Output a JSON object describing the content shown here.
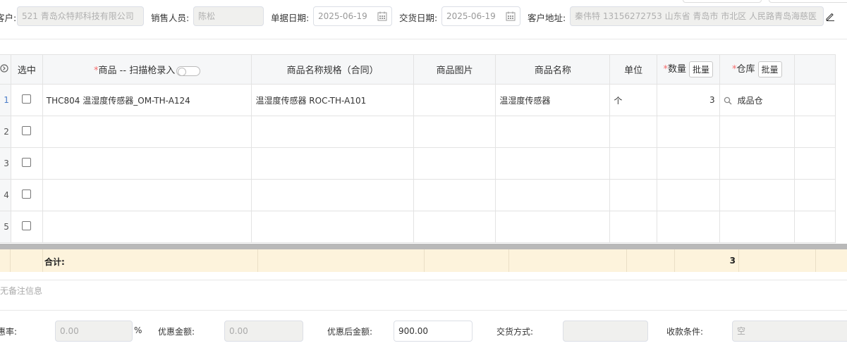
{
  "header": {
    "customer_label": "客户:",
    "customer_value": "521 青岛众特邦科技有限公司",
    "sales_label": "销售人员:",
    "sales_value": "陈松",
    "doc_date_label": "单据日期:",
    "doc_date_value": "2025-06-19",
    "delivery_date_label": "交货日期:",
    "delivery_date_value": "2025-06-19",
    "address_label": "客户地址:",
    "address_value": "秦伟特 13156272753 山东省 青岛市 市北区 人民路青岛海慈医"
  },
  "table": {
    "col_select": "选中",
    "col_product_prefix": "*",
    "col_product": "商品 -- 扫描枪录入",
    "col_spec": "商品名称规格（合同）",
    "col_image": "商品图片",
    "col_name": "商品名称",
    "col_unit": "单位",
    "col_qty_prefix": "*",
    "col_qty": "数量",
    "col_warehouse_prefix": "*",
    "col_warehouse": "仓库",
    "batch_label": "批量",
    "rows": [
      {
        "num": "1",
        "product": "THC804 温湿度传感器_OM-TH-A124",
        "spec": "温湿度传感器 ROC-TH-A101",
        "image": "",
        "name": "温湿度传感器",
        "unit": "个",
        "qty": "3",
        "warehouse": "成品仓"
      },
      {
        "num": "2",
        "product": "",
        "spec": "",
        "image": "",
        "name": "",
        "unit": "",
        "qty": "",
        "warehouse": ""
      },
      {
        "num": "3",
        "product": "",
        "spec": "",
        "image": "",
        "name": "",
        "unit": "",
        "qty": "",
        "warehouse": ""
      },
      {
        "num": "4",
        "product": "",
        "spec": "",
        "image": "",
        "name": "",
        "unit": "",
        "qty": "",
        "warehouse": ""
      },
      {
        "num": "5",
        "product": "",
        "spec": "",
        "image": "",
        "name": "",
        "unit": "",
        "qty": "",
        "warehouse": ""
      }
    ]
  },
  "summary": {
    "label": "合计:",
    "qty_total": "3"
  },
  "remark": {
    "text": "无备注信息"
  },
  "footer": {
    "discount_rate_label": "惠率:",
    "discount_rate_value": "0.00",
    "percent_sign": "%",
    "discount_amount_label": "优惠金额:",
    "discount_amount_value": "0.00",
    "after_discount_label": "优惠后金额:",
    "after_discount_value": "900.00",
    "delivery_method_label": "交货方式:",
    "delivery_method_value": "",
    "payment_terms_label": "收款条件:",
    "payment_terms_value": "空"
  }
}
